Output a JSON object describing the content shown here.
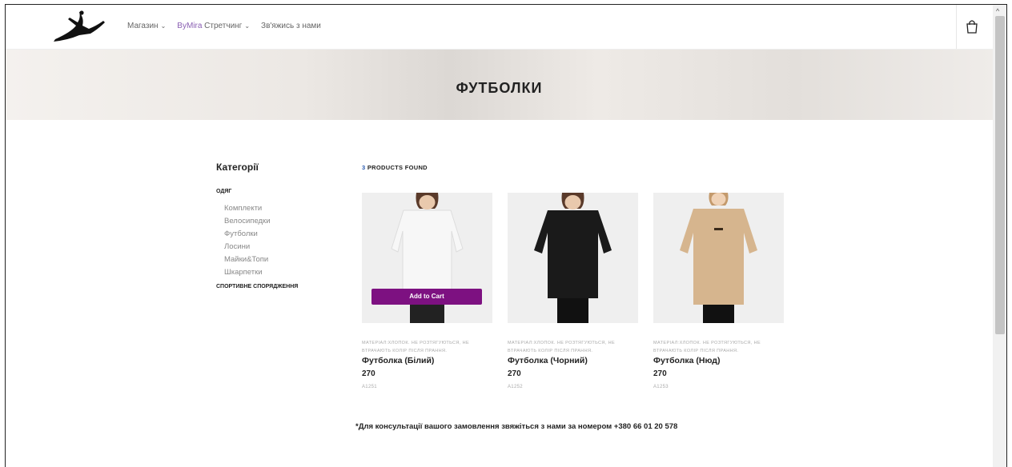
{
  "nav": {
    "items": [
      {
        "label": "Магазин"
      },
      {
        "label": "ByMira Стретчинг",
        "brand": "ByMira",
        "rest": " Стретчинг"
      },
      {
        "label": "Зв'яжись з нами"
      }
    ]
  },
  "icons": {
    "logo": "dancer-logo",
    "bag": "shopping-bag-icon",
    "chevron": "chevron-down-icon",
    "scroll_up": "arrow-up-icon"
  },
  "hero": {
    "title": "ФУТБОЛКИ"
  },
  "sidebar": {
    "title": "Категорії",
    "group1": "ОДЯГ",
    "links": [
      "Комплекти",
      "Велосипедки",
      "Футболки",
      "Лосини",
      "Майки&Топи",
      "Шкарпетки"
    ],
    "group2": "СПОРТИВНЕ СПОРЯДЖЕННЯ"
  },
  "results": {
    "count": "3",
    "label": " PRODUCTS FOUND"
  },
  "products": [
    {
      "desc": "МАТЕРІАЛ:ХЛОПОК. НЕ РОЗТЯГУЮТЬСЯ, НЕ ВТРАЧАЮТЬ КОЛІР ПІСЛЯ ПРАННЯ.",
      "name": "Футболка (Білий)",
      "price": "270",
      "sku": "A1251",
      "shirt": "#f7f7f7"
    },
    {
      "desc": "МАТЕРІАЛ:ХЛОПОК. НЕ РОЗТЯГУЮТЬСЯ, НЕ ВТРАЧАЮТЬ КОЛІР ПІСЛЯ ПРАННЯ.",
      "name": "Футболка (Чорний)",
      "price": "270",
      "sku": "A1252",
      "shirt": "#1a1a1a"
    },
    {
      "desc": "МАТЕРІАЛ:ХЛОПОК. НЕ РОЗТЯГУЮТЬСЯ, НЕ ВТРАЧАЮТЬ КОЛІР ПІСЛЯ ПРАННЯ.",
      "name": "Футболка (Нюд)",
      "price": "270",
      "sku": "A1253",
      "shirt": "#d6b58e"
    }
  ],
  "add_to_cart": "Add to Cart",
  "consult": "*Для консультації вашого замовлення звяжіться з нами за номером +380 66 01 20 578",
  "colors": {
    "accent": "#7d1181",
    "link": "#2b5bb0"
  }
}
